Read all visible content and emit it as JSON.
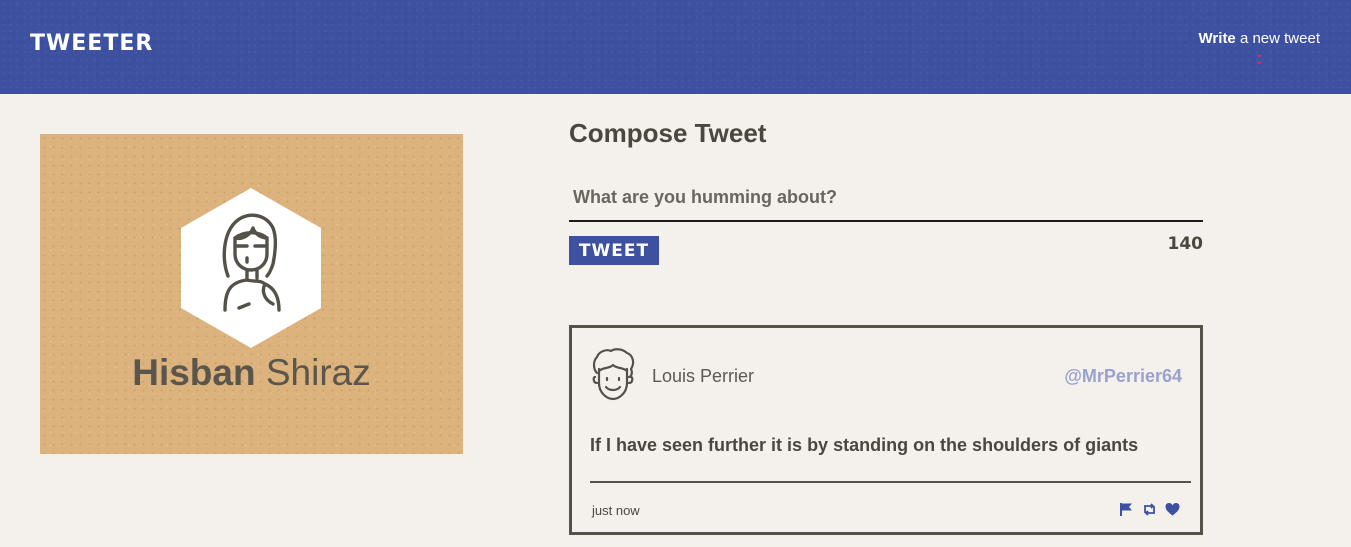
{
  "header": {
    "brand": "TWEETER",
    "write_bold": "Write",
    "write_rest": " a new tweet",
    "chevron_icon": "double-chevron-down-icon",
    "bg_color": "#3d51a0",
    "accent_color": "#e8334a"
  },
  "profile": {
    "first_name": "Hisban",
    "last_name": " Shiraz",
    "avatar_icon": "user-avatar-icon",
    "bg_color": "#dcb27d"
  },
  "compose": {
    "title": "Compose Tweet",
    "placeholder": "What are you humming about?",
    "button_label": "TWEET",
    "counter": "140"
  },
  "tweets": [
    {
      "name": "Louis Perrier",
      "handle": "@MrPerrier64",
      "text": "If I have seen further it is by standing on the shoulders of giants",
      "time": "just now",
      "actions": [
        "flag-icon",
        "retweet-icon",
        "heart-icon"
      ]
    }
  ]
}
